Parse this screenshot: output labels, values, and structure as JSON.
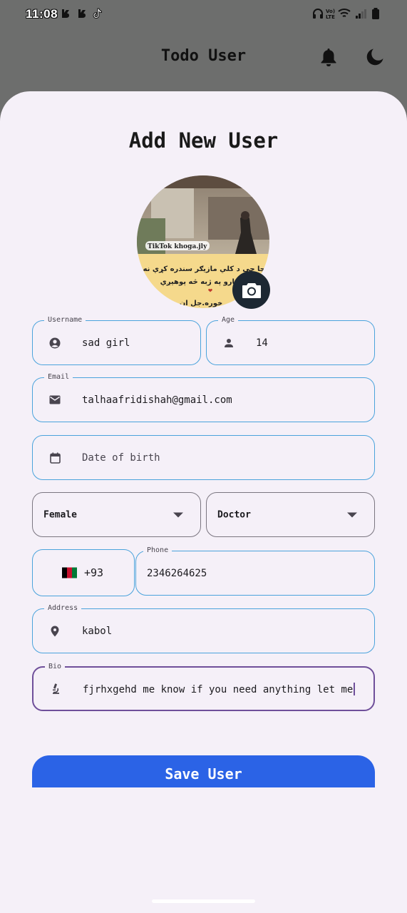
{
  "status_bar": {
    "time": "11:08",
    "network_label": "Vo) LTE",
    "left_icons": [
      "notification-b-icon",
      "notification-b-icon",
      "tiktok-icon"
    ],
    "right_icons": [
      "headphones-icon",
      "volte-icon",
      "wifi-icon",
      "signal-icon",
      "battery-icon"
    ]
  },
  "app_bar": {
    "title": "Todo User",
    "actions": [
      "bell-icon",
      "moon-icon"
    ]
  },
  "form": {
    "heading": "Add New User",
    "avatar": {
      "watermark": "TikTok khoga.jly",
      "caption_line1": "چا چې د کلي مازيګر سندره کړي نه وي",
      "caption_line2": "م د اشارو په ژبه څه پوهيږي",
      "caption_line3": "خوره.جل ان"
    },
    "username": {
      "label": "Username",
      "value": "sad girl"
    },
    "age": {
      "label": "Age",
      "value": "14"
    },
    "email": {
      "label": "Email",
      "value": "talhaafridishah@gmail.com"
    },
    "dob": {
      "placeholder": "Date of birth"
    },
    "gender": {
      "selected": "Female"
    },
    "profession": {
      "selected": "Doctor"
    },
    "country_code": {
      "flag": "🇦🇫",
      "value": "+93"
    },
    "phone": {
      "label": "Phone",
      "value": "2346264625"
    },
    "address": {
      "label": "Address",
      "value": "kabol"
    },
    "bio": {
      "label": "Bio",
      "value": "fjrhxgehd me know if you need anything let me"
    },
    "save_label": "Save User"
  },
  "colors": {
    "accent_blue": "#4aa3dc",
    "focus_purple": "#6f4f9a",
    "button_blue": "#2b63e6",
    "appbar_grey": "#6d6e6d",
    "card_bg": "#f5f0f8"
  }
}
